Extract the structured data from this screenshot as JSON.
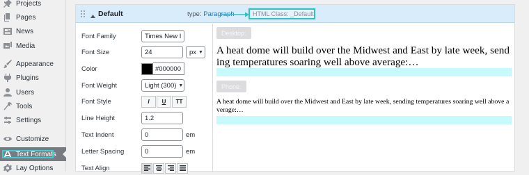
{
  "sidebar": {
    "items": [
      {
        "label": "Projects",
        "icon": "pin-icon"
      },
      {
        "label": "Pages",
        "icon": "pages-icon"
      },
      {
        "label": "News",
        "icon": "news-icon"
      },
      {
        "label": "Media",
        "icon": "media-icon"
      },
      {
        "label": "Appearance",
        "icon": "brush-icon"
      },
      {
        "label": "Plugins",
        "icon": "plugin-icon"
      },
      {
        "label": "Users",
        "icon": "user-icon"
      },
      {
        "label": "Tools",
        "icon": "wrench-icon"
      },
      {
        "label": "Settings",
        "icon": "settings-icon"
      },
      {
        "label": "Customize",
        "icon": "eye-icon"
      },
      {
        "label": "Text Formats",
        "icon": "text-format-icon",
        "active": true
      },
      {
        "label": "Lay Options",
        "icon": "gear-icon"
      }
    ],
    "highlight_color": "#3ccfcf"
  },
  "format": {
    "name": "Default",
    "type_prefix": "type:",
    "type_value": "Paragraph",
    "html_class": "HTML Class: _Default",
    "annotation_color": "#2dc3c3"
  },
  "form": {
    "font_family": {
      "label": "Font Family",
      "value": "Times New I"
    },
    "font_size": {
      "label": "Font Size",
      "value": "24",
      "unit": "px"
    },
    "color": {
      "label": "Color",
      "value": "#000000"
    },
    "font_weight": {
      "label": "Font Weight",
      "value": "Light (300)"
    },
    "font_style": {
      "label": "Font Style",
      "buttons": [
        "I",
        "U",
        "TT"
      ]
    },
    "line_height": {
      "label": "Line Height",
      "value": "1.2"
    },
    "text_indent": {
      "label": "Text Indent",
      "value": "0",
      "unit": "em"
    },
    "letter_spacing": {
      "label": "Letter Spacing",
      "value": "0",
      "unit": "em"
    },
    "text_align": {
      "label": "Text Align",
      "options": [
        "align-left-icon",
        "align-center-icon",
        "align-right-icon",
        "align-justify-icon"
      ],
      "selected": "align-left-icon"
    }
  },
  "preview": {
    "desktop_label": "Desktop:",
    "phone_label": "Phone:",
    "desktop_text": "A heat dome will build over the Midwest and East by late week, sending temperatures soaring well above average:…",
    "phone_text": "A heat dome will build over the Midwest and East by late week, sending temperatures soaring well above average:…",
    "highlight_color": "#c7fbfb"
  }
}
